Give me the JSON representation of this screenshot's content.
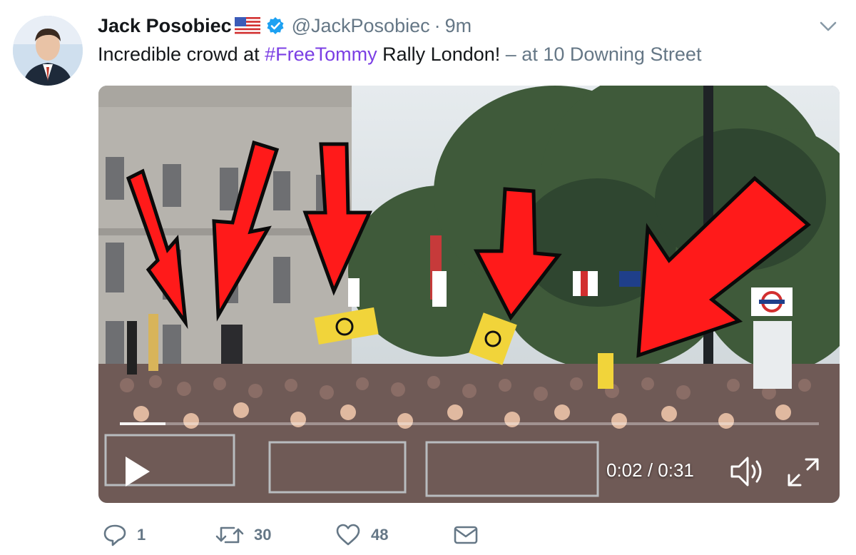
{
  "tweet": {
    "author_name": "Jack Posobiec",
    "handle": "@JackPosobiec",
    "separator": "·",
    "time": "9m",
    "text_before": "Incredible crowd at ",
    "hashtag": "#FreeTommy",
    "text_after": " Rally London!",
    "location": " – at 10 Downing Street"
  },
  "video": {
    "timecode": "0:02 / 0:31",
    "progress": 0.065
  },
  "actions": {
    "replies": "1",
    "retweets": "30",
    "likes": "48"
  },
  "icons": {
    "verified": "verified-badge-icon",
    "flag": "us-flag-icon",
    "menu": "chevron-down-icon",
    "play": "play-icon",
    "volume": "volume-icon",
    "fullscreen": "fullscreen-icon",
    "reply": "reply-icon",
    "retweet": "retweet-icon",
    "like": "heart-icon",
    "dm": "envelope-icon"
  },
  "colors": {
    "hashtag": "#7b3fe4",
    "verified": "#1da1f2",
    "secondary_text": "#657786",
    "annotation_arrow": "#ff1a1a"
  }
}
